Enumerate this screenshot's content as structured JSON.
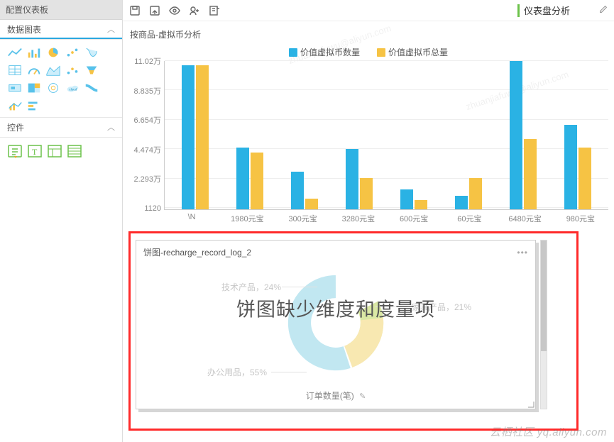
{
  "sidebar": {
    "panel_title": "配置仪表板",
    "charts_section": "数据图表",
    "controls_section": "控件"
  },
  "toolbar": {
    "dashboard_title": "仪表盘分析"
  },
  "legend": {
    "series1": "价值虚拟币数量",
    "series2": "价值虚拟币总量"
  },
  "chart1_title": "按商品-虚拟币分析",
  "pie": {
    "title": "饼图-recharge_record_log_2",
    "empty_msg": "饼图缺少维度和度量项",
    "footer": "订单数量(笔)",
    "slice_a": "技术产品，24%",
    "slice_b": "家具产品，21%",
    "slice_c": "办公用品，55%"
  },
  "watermark": "云栖社区 yq.aliyun.com",
  "wm_bg": "zhuanjiafuwu@aliyun.com",
  "chart_data": [
    {
      "type": "bar",
      "title": "按商品-虚拟币分析",
      "xlabel": "",
      "ylabel": "",
      "ylim": [
        0,
        110200
      ],
      "y_ticks_display": [
        "1120",
        "2.293万",
        "4.474万",
        "6.654万",
        "8.835万",
        "11.02万"
      ],
      "y_ticks": [
        1120,
        22930,
        44740,
        66540,
        88350,
        110200
      ],
      "categories": [
        "\\N",
        "1980元宝",
        "300元宝",
        "3280元宝",
        "600元宝",
        "60元宝",
        "6480元宝",
        "980元宝"
      ],
      "series": [
        {
          "name": "价值虚拟币数量",
          "color": "#2ab2e4",
          "values": [
            107000,
            46000,
            28000,
            45000,
            15000,
            10000,
            110200,
            63000
          ]
        },
        {
          "name": "价值虚拟币总量",
          "color": "#f6c344",
          "values": [
            107000,
            42000,
            8000,
            23000,
            7000,
            23000,
            52000,
            46000
          ]
        }
      ]
    },
    {
      "type": "pie",
      "title": "饼图-recharge_record_log_2",
      "footer_metric": "订单数量(笔)",
      "empty": true,
      "empty_message": "饼图缺少维度和度量项",
      "placeholder_slices": [
        {
          "name": "技术产品",
          "value": 24,
          "color": "#bcd65a"
        },
        {
          "name": "家具产品",
          "value": 21,
          "color": "#f3d673"
        },
        {
          "name": "办公用品",
          "value": 55,
          "color": "#8fd5e6"
        }
      ]
    }
  ]
}
